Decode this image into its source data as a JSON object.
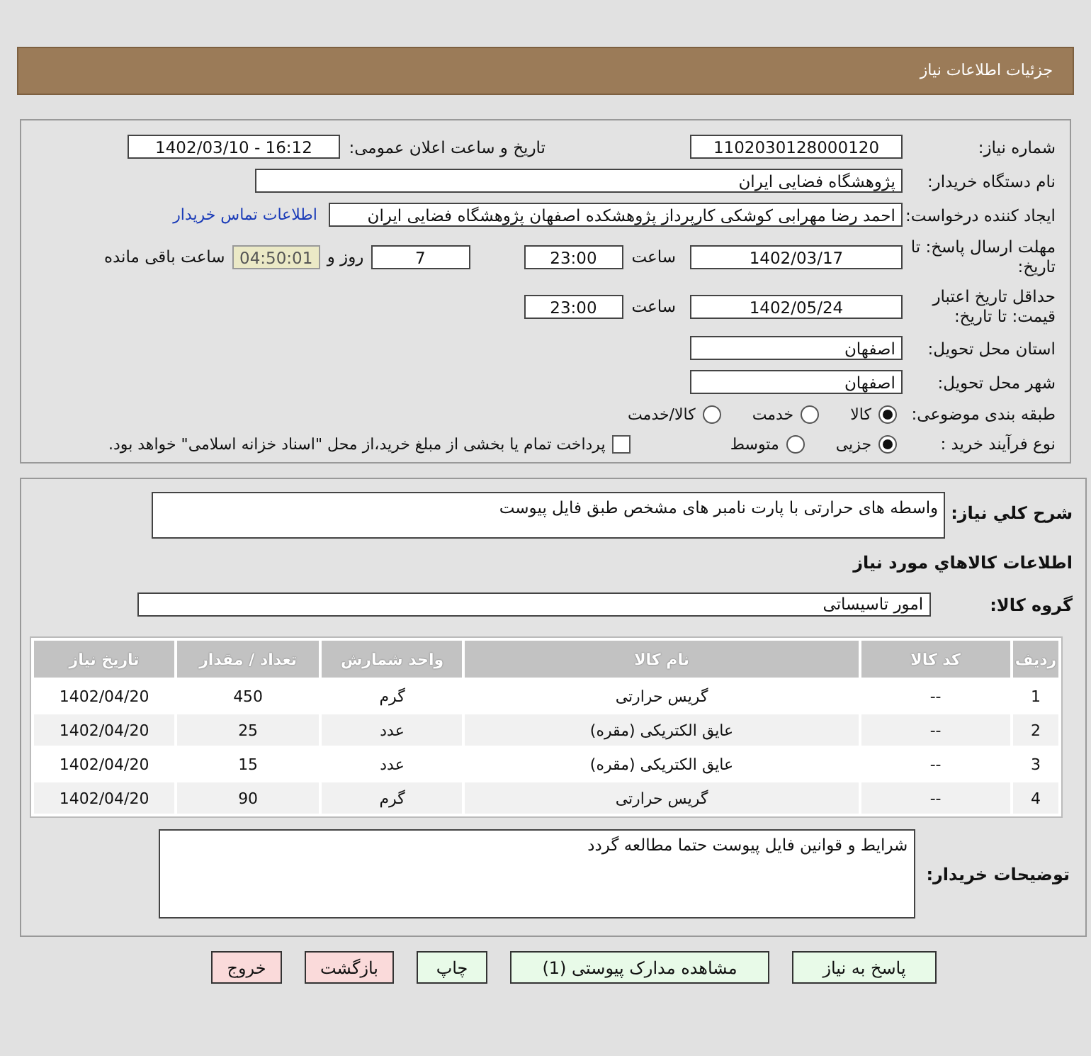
{
  "page_title": "جزئیات اطلاعات نیاز",
  "need_info": {
    "need_number": {
      "label": "شماره نیاز:",
      "value": "1102030128000120"
    },
    "announce_datetime": {
      "label": "تاریخ و ساعت اعلان عمومی:",
      "value": "1402/03/10 - 16:12"
    },
    "buyer_org": {
      "label": "نام دستگاه خریدار:",
      "value": "پژوهشگاه فضایی ایران"
    },
    "requester": {
      "label": "ایجاد کننده درخواست:",
      "value": "احمد رضا مهرابی کوشکی کارپرداز پژوهشکده اصفهان پژوهشگاه فضایی ایران"
    },
    "contact_link": "اطلاعات تماس خریدار",
    "reply_deadline": {
      "label": "مهلت ارسال پاسخ: تا تاریخ:",
      "date": "1402/03/17",
      "time_label": "ساعت",
      "time": "23:00",
      "days": "7",
      "days_label": "روز و",
      "remaining": "04:50:01",
      "remaining_label": "ساعت باقی مانده"
    },
    "price_validity": {
      "label": "حداقل تاریخ اعتبار قیمت: تا تاریخ:",
      "date": "1402/05/24",
      "time_label": "ساعت",
      "time": "23:00"
    },
    "province": {
      "label": "استان محل تحویل:",
      "value": "اصفهان"
    },
    "city": {
      "label": "شهر محل تحویل:",
      "value": "اصفهان"
    },
    "category": {
      "label": "طبقه بندی موضوعی:",
      "options": [
        {
          "label": "کالا",
          "selected": true
        },
        {
          "label": "خدمت",
          "selected": false
        },
        {
          "label": "کالا/خدمت",
          "selected": false
        }
      ]
    },
    "process": {
      "label": "نوع فرآیند خرید :",
      "options": [
        {
          "label": "جزیی",
          "selected": true
        },
        {
          "label": "متوسط",
          "selected": false
        }
      ],
      "treasury": {
        "label": "پرداخت تمام یا بخشی از مبلغ خرید،از محل \"اسناد خزانه اسلامی\" خواهد بود.",
        "checked": false
      }
    }
  },
  "items_info": {
    "description": {
      "label": "شرح کلي نياز:",
      "value": "واسطه های حرارتی با پارت نامبر های مشخص طبق  فایل پیوست"
    },
    "section_title": "اطلاعات کالاهاي مورد نياز",
    "goods_group": {
      "label": "گروه کالا:",
      "value": "امور تاسیساتی"
    },
    "table": {
      "columns": [
        "ردیف",
        "کد کالا",
        "نام کالا",
        "واحد شمارش",
        "تعداد / مقدار",
        "تاریخ نیاز"
      ],
      "rows": [
        [
          "1",
          "--",
          "گریس حرارتی",
          "گرم",
          "450",
          "1402/04/20"
        ],
        [
          "2",
          "--",
          "عایق الکتریکی (مقره)",
          "عدد",
          "25",
          "1402/04/20"
        ],
        [
          "3",
          "--",
          "عایق الکتریکی (مقره)",
          "عدد",
          "15",
          "1402/04/20"
        ],
        [
          "4",
          "--",
          "گریس حرارتی",
          "گرم",
          "90",
          "1402/04/20"
        ]
      ]
    },
    "buyer_notes": {
      "label": "توضیحات خریدار:",
      "value": "شرایط و قوانین فایل پیوست حتما مطالعه گردد"
    }
  },
  "buttons": [
    {
      "label": "پاسخ به نیاز",
      "kind": "action"
    },
    {
      "label": "مشاهده مدارک پیوستی (1)",
      "kind": "action"
    },
    {
      "label": "چاپ",
      "kind": "action"
    },
    {
      "label": "بازگشت",
      "kind": "exit"
    },
    {
      "label": "خروج",
      "kind": "exit"
    }
  ]
}
